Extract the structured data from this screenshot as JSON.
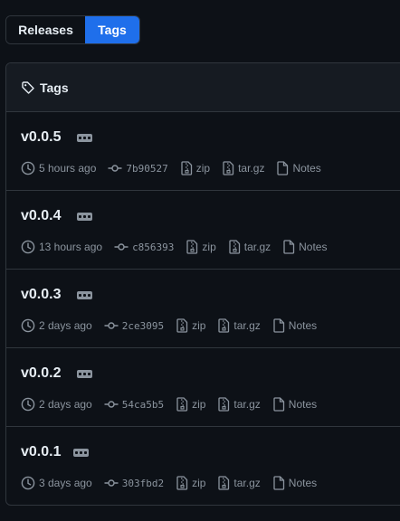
{
  "tabs": {
    "releases": "Releases",
    "tags": "Tags"
  },
  "box": {
    "title": "Tags"
  },
  "tags": [
    {
      "name": "v0.0.5",
      "time": "5 hours ago",
      "commit": "7b90527",
      "zip": "zip",
      "targz": "tar.gz",
      "notes": "Notes"
    },
    {
      "name": "v0.0.4",
      "time": "13 hours ago",
      "commit": "c856393",
      "zip": "zip",
      "targz": "tar.gz",
      "notes": "Notes"
    },
    {
      "name": "v0.0.3",
      "time": "2 days ago",
      "commit": "2ce3095",
      "zip": "zip",
      "targz": "tar.gz",
      "notes": "Notes"
    },
    {
      "name": "v0.0.2",
      "time": "2 days ago",
      "commit": "54ca5b5",
      "zip": "zip",
      "targz": "tar.gz",
      "notes": "Notes"
    },
    {
      "name": "v0.0.1",
      "time": "3 days ago",
      "commit": "303fbd2",
      "zip": "zip",
      "targz": "tar.gz",
      "notes": "Notes"
    }
  ],
  "colors": {
    "background": "#0d1117",
    "accent": "#1f6feb",
    "muted_text": "#8b949e",
    "border": "#30363d"
  }
}
